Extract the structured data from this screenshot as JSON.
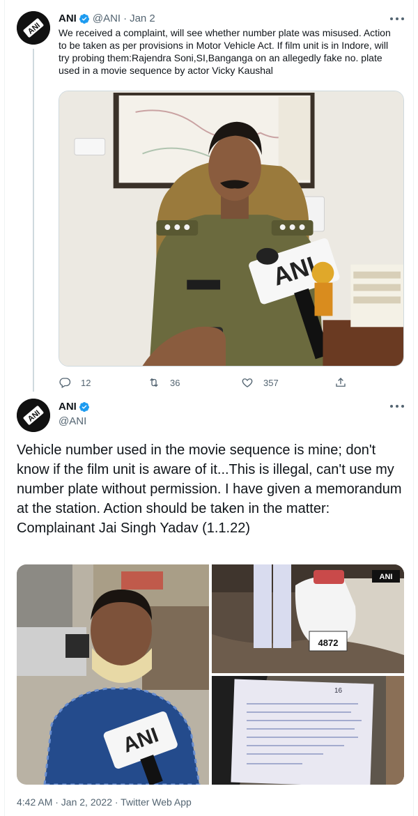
{
  "tweet1": {
    "name": "ANI",
    "handle": "@ANI",
    "separator": "·",
    "date": "Jan 2",
    "text": "We received a complaint, will see whether number plate was misused. Action to be taken as per provisions in Motor Vehicle Act. If film unit is in Indore, will try probing them:Rajendra Soni,SI,Banganga on an allegedly fake no. plate used in a movie sequence by actor Vicky Kaushal",
    "media_logo": "ANI",
    "stats": {
      "replies": "12",
      "retweets": "36",
      "likes": "357"
    }
  },
  "tweet2": {
    "name": "ANI",
    "handle": "@ANI",
    "text": "Vehicle number used in the movie sequence is mine; don't know if the film unit is aware of it...This is illegal, can't use my number plate without permission. I have given a memorandum at the station. Action should be taken in the matter: Complainant Jai Singh Yadav (1.1.22)",
    "media_logo": "ANI",
    "plate_text": "4872",
    "note_number": "16",
    "timestamp": "4:42 AM · Jan 2, 2022 · Twitter Web App"
  },
  "colors": {
    "verified": "#1d9bf0",
    "secondary_text": "#536471",
    "thread_line": "#cfd9de"
  },
  "icons": [
    "reply-icon",
    "retweet-icon",
    "like-icon",
    "share-icon",
    "verified-icon",
    "more-icon"
  ]
}
